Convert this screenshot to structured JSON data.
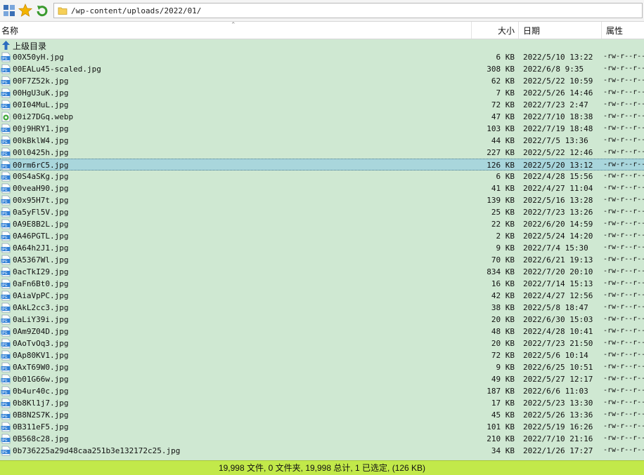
{
  "toolbar": {
    "icons": [
      "layout-icon",
      "star-icon",
      "refresh-icon"
    ],
    "path": "/wp-content/uploads/2022/01/"
  },
  "columns": {
    "name": "名称",
    "size": "大小",
    "date": "日期",
    "attr": "属性"
  },
  "parent_label": "上级目录",
  "files": [
    {
      "name": "00X50yH.jpg",
      "size": "6 KB",
      "date": "2022/5/10 13:22",
      "attr": "-rw-r--r--",
      "type": "jpg"
    },
    {
      "name": "00EALu45-scaled.jpg",
      "size": "308 KB",
      "date": "2022/6/8 9:35",
      "attr": "-rw-r--r--",
      "type": "jpg"
    },
    {
      "name": "00F7Z52k.jpg",
      "size": "62 KB",
      "date": "2022/5/22 10:59",
      "attr": "-rw-r--r--",
      "type": "jpg"
    },
    {
      "name": "00HgU3uK.jpg",
      "size": "7 KB",
      "date": "2022/5/26 14:46",
      "attr": "-rw-r--r--",
      "type": "jpg"
    },
    {
      "name": "00I04MuL.jpg",
      "size": "72 KB",
      "date": "2022/7/23 2:47",
      "attr": "-rw-r--r--",
      "type": "jpg"
    },
    {
      "name": "00i27DGq.webp",
      "size": "47 KB",
      "date": "2022/7/10 18:38",
      "attr": "-rw-r--r--",
      "type": "webp"
    },
    {
      "name": "00j9HRY1.jpg",
      "size": "103 KB",
      "date": "2022/7/19 18:48",
      "attr": "-rw-r--r--",
      "type": "jpg"
    },
    {
      "name": "00kBklW4.jpg",
      "size": "44 KB",
      "date": "2022/7/5 13:36",
      "attr": "-rw-r--r--",
      "type": "jpg"
    },
    {
      "name": "00l0425h.jpg",
      "size": "227 KB",
      "date": "2022/5/22 12:46",
      "attr": "-rw-r--r--",
      "type": "jpg"
    },
    {
      "name": "00rm6rC5.jpg",
      "size": "126 KB",
      "date": "2022/5/20 13:12",
      "attr": "-rw-r--r--",
      "type": "jpg",
      "selected": true
    },
    {
      "name": "00S4aSKg.jpg",
      "size": "6 KB",
      "date": "2022/4/28 15:56",
      "attr": "-rw-r--r--",
      "type": "jpg"
    },
    {
      "name": "00veaH90.jpg",
      "size": "41 KB",
      "date": "2022/4/27 11:04",
      "attr": "-rw-r--r--",
      "type": "jpg"
    },
    {
      "name": "00x95H7t.jpg",
      "size": "139 KB",
      "date": "2022/5/16 13:28",
      "attr": "-rw-r--r--",
      "type": "jpg"
    },
    {
      "name": "0a5yFl5V.jpg",
      "size": "25 KB",
      "date": "2022/7/23 13:26",
      "attr": "-rw-r--r--",
      "type": "jpg"
    },
    {
      "name": "0A9E8B2L.jpg",
      "size": "22 KB",
      "date": "2022/6/20 14:59",
      "attr": "-rw-r--r--",
      "type": "jpg"
    },
    {
      "name": "0A46PGTL.jpg",
      "size": "2 KB",
      "date": "2022/5/24 14:20",
      "attr": "-rw-r--r--",
      "type": "jpg"
    },
    {
      "name": "0A64h2J1.jpg",
      "size": "9 KB",
      "date": "2022/7/4 15:30",
      "attr": "-rw-r--r--",
      "type": "jpg"
    },
    {
      "name": "0A5367Wl.jpg",
      "size": "70 KB",
      "date": "2022/6/21 19:13",
      "attr": "-rw-r--r--",
      "type": "jpg"
    },
    {
      "name": "0acTkI29.jpg",
      "size": "834 KB",
      "date": "2022/7/20 20:10",
      "attr": "-rw-r--r--",
      "type": "jpg"
    },
    {
      "name": "0aFn6Bt0.jpg",
      "size": "16 KB",
      "date": "2022/7/14 15:13",
      "attr": "-rw-r--r--",
      "type": "jpg"
    },
    {
      "name": "0AiaVpPC.jpg",
      "size": "42 KB",
      "date": "2022/4/27 12:56",
      "attr": "-rw-r--r--",
      "type": "jpg"
    },
    {
      "name": "0AkL2cc3.jpg",
      "size": "38 KB",
      "date": "2022/5/8 18:47",
      "attr": "-rw-r--r--",
      "type": "jpg"
    },
    {
      "name": "0aLiY39i.jpg",
      "size": "20 KB",
      "date": "2022/6/30 15:03",
      "attr": "-rw-r--r--",
      "type": "jpg"
    },
    {
      "name": "0Am9Z04D.jpg",
      "size": "48 KB",
      "date": "2022/4/28 10:41",
      "attr": "-rw-r--r--",
      "type": "jpg"
    },
    {
      "name": "0AoTvOq3.jpg",
      "size": "20 KB",
      "date": "2022/7/23 21:50",
      "attr": "-rw-r--r--",
      "type": "jpg"
    },
    {
      "name": "0Ap80KV1.jpg",
      "size": "72 KB",
      "date": "2022/5/6 10:14",
      "attr": "-rw-r--r--",
      "type": "jpg"
    },
    {
      "name": "0AxT69W0.jpg",
      "size": "9 KB",
      "date": "2022/6/25 10:51",
      "attr": "-rw-r--r--",
      "type": "jpg"
    },
    {
      "name": "0b01G66w.jpg",
      "size": "49 KB",
      "date": "2022/5/27 12:17",
      "attr": "-rw-r--r--",
      "type": "jpg"
    },
    {
      "name": "0b4ur40c.jpg",
      "size": "187 KB",
      "date": "2022/6/6 11:03",
      "attr": "-rw-r--r--",
      "type": "jpg"
    },
    {
      "name": "0b8Kl1j7.jpg",
      "size": "17 KB",
      "date": "2022/5/23 13:30",
      "attr": "-rw-r--r--",
      "type": "jpg"
    },
    {
      "name": "0B8N2S7K.jpg",
      "size": "45 KB",
      "date": "2022/5/26 13:36",
      "attr": "-rw-r--r--",
      "type": "jpg"
    },
    {
      "name": "0B311eF5.jpg",
      "size": "101 KB",
      "date": "2022/5/19 16:26",
      "attr": "-rw-r--r--",
      "type": "jpg"
    },
    {
      "name": "0B568c28.jpg",
      "size": "210 KB",
      "date": "2022/7/10 21:16",
      "attr": "-rw-r--r--",
      "type": "jpg"
    },
    {
      "name": "0b736225a29d48caa251b3e132172c25.jpg",
      "size": "34 KB",
      "date": "2022/1/26 17:27",
      "attr": "-rw-r--r--",
      "type": "jpg"
    }
  ],
  "status": "19,998 文件, 0 文件夹, 19,998 总计, 1 已选定, (126 KB)",
  "colors": {
    "list_bg": "#cfe8d2",
    "selected_bg": "#a9d6dc",
    "status_bg": "#c2e94a"
  }
}
